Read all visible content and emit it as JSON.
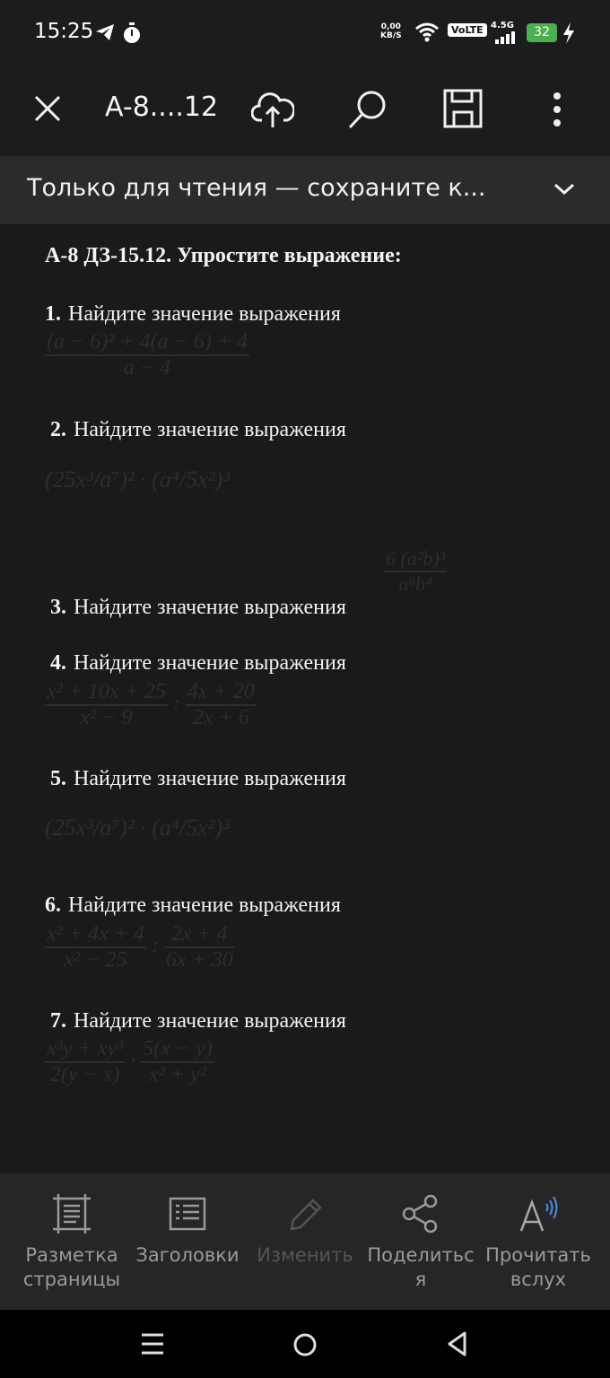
{
  "status_bar": {
    "time": "15:25",
    "net_speed_value": "0,00",
    "net_speed_unit": "KB/S",
    "volte": "VoLTE",
    "network_type": "4.5G",
    "battery": "32"
  },
  "toolbar": {
    "title": "A-8....12"
  },
  "banner": {
    "text": "Только для чтения — сохраните к..."
  },
  "document": {
    "heading": "А-8 ДЗ-15.12. Упростите выражение:",
    "tasks": [
      {
        "num": "1.",
        "text": "Найдите значение выражения"
      },
      {
        "num": "2.",
        "text": "Найдите значение выражения"
      },
      {
        "num": "3.",
        "text": "Найдите значение выражения"
      },
      {
        "num": "4.",
        "text": "Найдите значение выражения"
      },
      {
        "num": "5.",
        "text": "Найдите значение выражения"
      },
      {
        "num": "6.",
        "text": "Найдите значение выражения"
      },
      {
        "num": "7.",
        "text": "Найдите значение выражения"
      }
    ],
    "formulas": {
      "f1_num": "(a − 6)² + 4(a − 6) + 4",
      "f1_den": "a − 4",
      "f2": "(25x³/a⁷)² · (a⁴/5x²)³",
      "f3_num": "6 (a²b)³",
      "f3_den": "a⁶b⁴",
      "f4_num1": "x² + 10x + 25",
      "f4_den1": "x² − 9",
      "f4_op": ":",
      "f4_num2": "4x + 20",
      "f4_den2": "2x + 6",
      "f5": "(25x³/a⁷)² · (a⁴/5x²)³",
      "f6_num1": "x² + 4x + 4",
      "f6_den1": "x² − 25",
      "f6_op": ":",
      "f6_num2": "2x + 4",
      "f6_den2": "6x + 30",
      "f7_num1": "x³y + xy³",
      "f7_den1": "2(y − x)",
      "f7_op": "·",
      "f7_num2": "5(x − y)",
      "f7_den2": "x² + y²"
    }
  },
  "bottom_bar": {
    "items": [
      {
        "label_line1": "Разметка",
        "label_line2": "страницы",
        "icon": "page-layout-icon"
      },
      {
        "label_line1": "Заголовки",
        "label_line2": "",
        "icon": "headings-icon"
      },
      {
        "label_line1": "Изменить",
        "label_line2": "",
        "icon": "pencil-icon"
      },
      {
        "label_line1": "Поделитьс",
        "label_line2": "я",
        "icon": "share-icon"
      },
      {
        "label_line1": "Прочитать",
        "label_line2": "вслух",
        "icon": "read-aloud-icon"
      }
    ]
  },
  "colors": {
    "background": "#1c1c1c",
    "banner": "#2b2b2b",
    "bottom_bar": "#262626",
    "battery": "#4caf50"
  }
}
